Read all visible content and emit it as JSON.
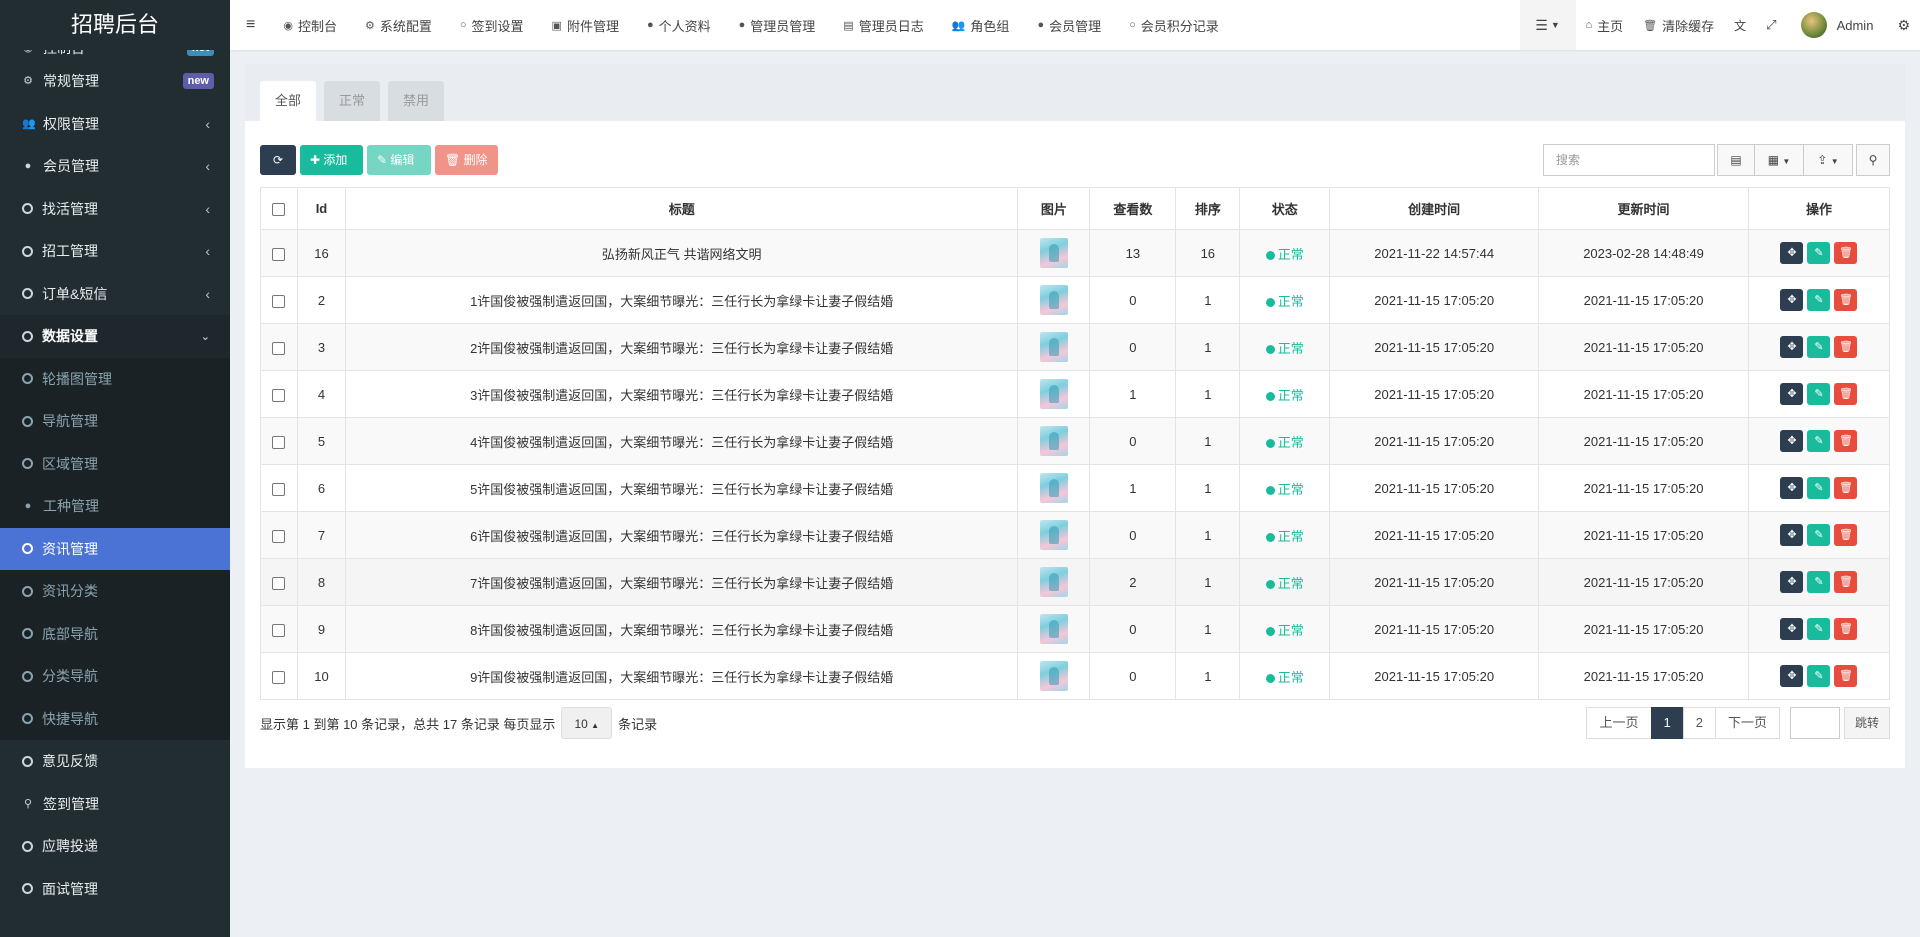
{
  "app": {
    "title": "招聘后台"
  },
  "sidebar": {
    "items": [
      {
        "label": "控制台",
        "badge": "hot"
      },
      {
        "label": "常规管理",
        "badge": "new"
      },
      {
        "label": "权限管理"
      },
      {
        "label": "会员管理"
      },
      {
        "label": "找活管理"
      },
      {
        "label": "招工管理"
      },
      {
        "label": "订单&短信"
      },
      {
        "label": "数据设置"
      }
    ],
    "subitems": [
      {
        "label": "轮播图管理"
      },
      {
        "label": "导航管理"
      },
      {
        "label": "区域管理"
      },
      {
        "label": "工种管理"
      },
      {
        "label": "资讯管理"
      },
      {
        "label": "资讯分类"
      },
      {
        "label": "底部导航"
      },
      {
        "label": "分类导航"
      },
      {
        "label": "快捷导航"
      }
    ],
    "bottom_items": [
      {
        "label": "意见反馈"
      },
      {
        "label": "签到管理"
      },
      {
        "label": "应聘投递"
      },
      {
        "label": "面试管理"
      }
    ]
  },
  "topnav": {
    "tabs": [
      "控制台",
      "系统配置",
      "签到设置",
      "附件管理",
      "个人资料",
      "管理员管理",
      "管理员日志",
      "角色组",
      "会员管理",
      "会员积分记录"
    ],
    "home": "主页",
    "clear_cache": "清除缓存",
    "user": "Admin"
  },
  "filter_tabs": [
    "全部",
    "正常",
    "禁用"
  ],
  "toolbar": {
    "add": "添加",
    "edit": "编辑",
    "delete": "删除",
    "search_placeholder": "搜索"
  },
  "table": {
    "headers": [
      "Id",
      "标题",
      "图片",
      "查看数",
      "排序",
      "状态",
      "创建时间",
      "更新时间",
      "操作"
    ],
    "rows": [
      {
        "id": "16",
        "title": "弘扬新风正气 共谐网络文明",
        "views": "13",
        "sort": "16",
        "status": "正常",
        "created": "2021-11-22 14:57:44",
        "updated": "2023-02-28 14:48:49"
      },
      {
        "id": "2",
        "title": "1许国俊被强制遣返回国，大案细节曝光：三任行长为拿绿卡让妻子假结婚",
        "views": "0",
        "sort": "1",
        "status": "正常",
        "created": "2021-11-15 17:05:20",
        "updated": "2021-11-15 17:05:20"
      },
      {
        "id": "3",
        "title": "2许国俊被强制遣返回国，大案细节曝光：三任行长为拿绿卡让妻子假结婚",
        "views": "0",
        "sort": "1",
        "status": "正常",
        "created": "2021-11-15 17:05:20",
        "updated": "2021-11-15 17:05:20"
      },
      {
        "id": "4",
        "title": "3许国俊被强制遣返回国，大案细节曝光：三任行长为拿绿卡让妻子假结婚",
        "views": "1",
        "sort": "1",
        "status": "正常",
        "created": "2021-11-15 17:05:20",
        "updated": "2021-11-15 17:05:20"
      },
      {
        "id": "5",
        "title": "4许国俊被强制遣返回国，大案细节曝光：三任行长为拿绿卡让妻子假结婚",
        "views": "0",
        "sort": "1",
        "status": "正常",
        "created": "2021-11-15 17:05:20",
        "updated": "2021-11-15 17:05:20"
      },
      {
        "id": "6",
        "title": "5许国俊被强制遣返回国，大案细节曝光：三任行长为拿绿卡让妻子假结婚",
        "views": "1",
        "sort": "1",
        "status": "正常",
        "created": "2021-11-15 17:05:20",
        "updated": "2021-11-15 17:05:20"
      },
      {
        "id": "7",
        "title": "6许国俊被强制遣返回国，大案细节曝光：三任行长为拿绿卡让妻子假结婚",
        "views": "0",
        "sort": "1",
        "status": "正常",
        "created": "2021-11-15 17:05:20",
        "updated": "2021-11-15 17:05:20"
      },
      {
        "id": "8",
        "title": "7许国俊被强制遣返回国，大案细节曝光：三任行长为拿绿卡让妻子假结婚",
        "views": "2",
        "sort": "1",
        "status": "正常",
        "created": "2021-11-15 17:05:20",
        "updated": "2021-11-15 17:05:20"
      },
      {
        "id": "9",
        "title": "8许国俊被强制遣返回国，大案细节曝光：三任行长为拿绿卡让妻子假结婚",
        "views": "0",
        "sort": "1",
        "status": "正常",
        "created": "2021-11-15 17:05:20",
        "updated": "2021-11-15 17:05:20"
      },
      {
        "id": "10",
        "title": "9许国俊被强制遣返回国，大案细节曝光：三任行长为拿绿卡让妻子假结婚",
        "views": "0",
        "sort": "1",
        "status": "正常",
        "created": "2021-11-15 17:05:20",
        "updated": "2021-11-15 17:05:20"
      }
    ]
  },
  "pagination": {
    "summary_prefix": "显示第 1 到第 10 条记录，总共 17 条记录 每页显示",
    "page_size": "10",
    "summary_suffix": "条记录",
    "prev": "上一页",
    "pages": [
      "1",
      "2"
    ],
    "next": "下一页",
    "jump": "跳转"
  },
  "colors": {
    "sidebar_bg": "#222d32",
    "active_menu": "#4b73d6",
    "success": "#18bc9c",
    "danger": "#e74c3c",
    "primary_dark": "#2c3e50"
  }
}
